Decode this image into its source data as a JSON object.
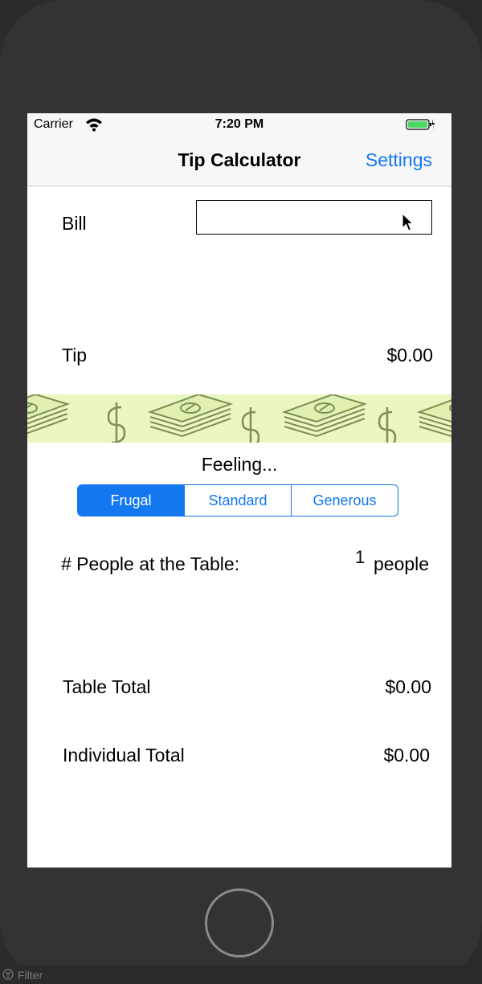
{
  "status_bar": {
    "carrier": "Carrier",
    "time": "7:20 PM"
  },
  "nav": {
    "title": "Tip Calculator",
    "settings_label": "Settings"
  },
  "bill": {
    "label": "Bill",
    "value": "",
    "placeholder": ""
  },
  "tip": {
    "label": "Tip",
    "value": "$0.00"
  },
  "feeling": {
    "label": "Feeling...",
    "options": [
      "Frugal",
      "Standard",
      "Generous"
    ],
    "selected": "Frugal"
  },
  "people": {
    "label": "# People at the Table:",
    "count": "1",
    "unit": "people"
  },
  "table_total": {
    "label": "Table Total",
    "value": "$0.00"
  },
  "individual_total": {
    "label": "Individual Total",
    "value": "$0.00"
  },
  "ide": {
    "filter_placeholder": "Filter"
  },
  "colors": {
    "accent": "#1378f0",
    "banner_bg": "#eaf7c2",
    "battery": "#4cd964"
  }
}
